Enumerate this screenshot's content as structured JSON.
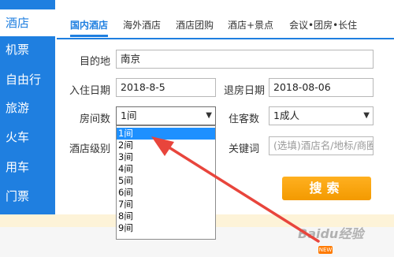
{
  "sidebar": {
    "items": [
      {
        "label": "酒店",
        "active": true
      },
      {
        "label": "机票"
      },
      {
        "label": "自由行"
      },
      {
        "label": "旅游"
      },
      {
        "label": "火车"
      },
      {
        "label": "用车"
      },
      {
        "label": "门票"
      }
    ]
  },
  "tabs": [
    {
      "label": "国内酒店",
      "active": true
    },
    {
      "label": "海外酒店"
    },
    {
      "label": "酒店团购"
    },
    {
      "label": "酒店+景点"
    },
    {
      "label": "会议•团房•长住"
    }
  ],
  "form": {
    "destination": {
      "label": "目的地",
      "value": "南京"
    },
    "checkin": {
      "label": "入住日期",
      "value": "2018-8-5"
    },
    "checkout": {
      "label": "退房日期",
      "value": "2018-08-06"
    },
    "rooms": {
      "label": "房间数",
      "value": "1间"
    },
    "guests": {
      "label": "住客数",
      "value": "1成人"
    },
    "hotel_level": {
      "label": "酒店级别"
    },
    "keyword": {
      "label": "关键词",
      "placeholder": "(选填)酒店名/地标/商圈"
    }
  },
  "rooms_dropdown": {
    "options": [
      "1间",
      "2间",
      "3间",
      "4间",
      "5间",
      "6间",
      "7间",
      "8间",
      "9间"
    ],
    "selected_index": 0
  },
  "search_button": {
    "label": "搜索"
  },
  "badges": {
    "new": "NEW"
  },
  "watermark": "Baidu经验",
  "colors": {
    "brand_blue": "#1f7fe0",
    "search_orange": "#f39a00",
    "selection_blue": "#1e90ff",
    "arrow_red": "#e8453c"
  }
}
